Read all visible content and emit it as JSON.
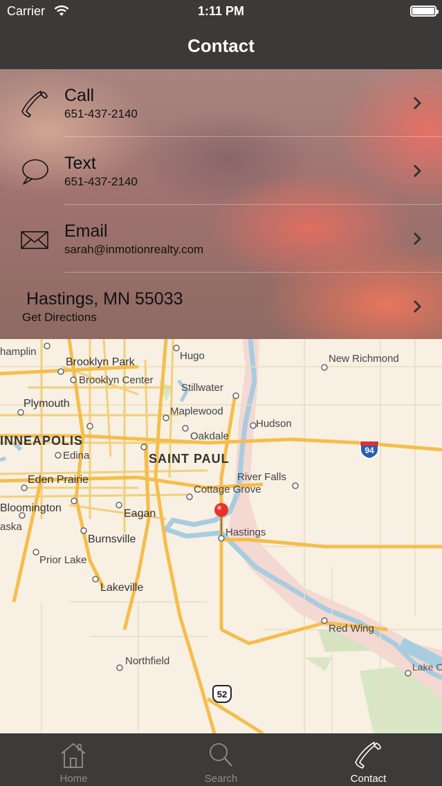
{
  "status_bar": {
    "carrier": "Carrier",
    "time": "1:11 PM"
  },
  "nav": {
    "title": "Contact"
  },
  "contact": {
    "rows": [
      {
        "label": "Call",
        "value": "651-437-2140",
        "icon": "phone-icon"
      },
      {
        "label": "Text",
        "value": "651-437-2140",
        "icon": "speech-bubble-icon"
      },
      {
        "label": "Email",
        "value": "sarah@inmotionrealty.com",
        "icon": "envelope-icon"
      },
      {
        "label": "Hastings, MN 55033",
        "value": "Get Directions",
        "icon": ""
      }
    ]
  },
  "map": {
    "places": [
      "New Richmond",
      "Hugo",
      "Stillwater",
      "Brooklyn Park",
      "Brooklyn Center",
      "hamplin",
      "Plymouth",
      "Maplewood",
      "Hudson",
      "Oakdale",
      "INNEAPOLIS",
      "Edina",
      "SAINT PAUL",
      "Eden Prairie",
      "River Falls",
      "Cottage Grove",
      "Bloomington",
      "Eagan",
      "aska",
      "Hastings",
      "Burnsville",
      "Prior Lake",
      "Lakeville",
      "Red Wing",
      "Northfield",
      "Lake C"
    ],
    "shields": [
      "94",
      "52"
    ],
    "pin_location": "Hastings"
  },
  "tabs": [
    {
      "label": "Home",
      "icon": "house-icon",
      "active": false
    },
    {
      "label": "Search",
      "icon": "magnifier-icon",
      "active": false
    },
    {
      "label": "Contact",
      "icon": "phone-icon",
      "active": true
    }
  ]
}
